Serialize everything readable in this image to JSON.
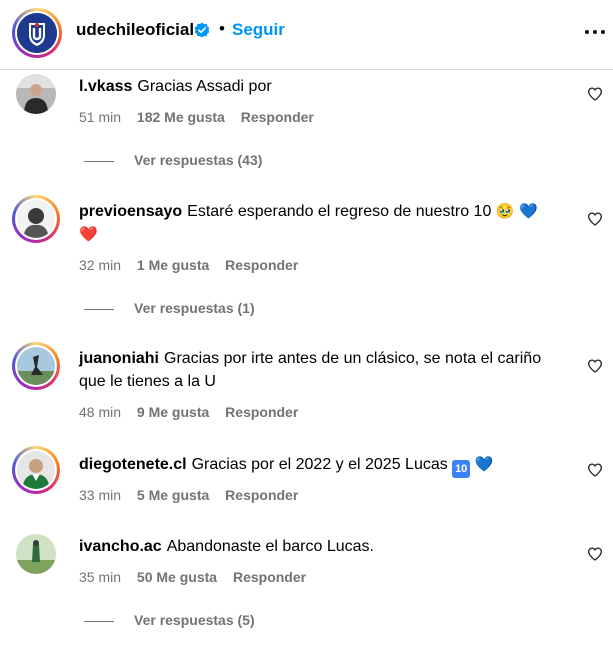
{
  "header": {
    "username": "udechileoficial",
    "separator": "•",
    "follow_label": "Seguir"
  },
  "comments": [
    {
      "user": "l.vkass",
      "text": "Gracias Assadi por",
      "time": "51 min",
      "likes": "182 Me gusta",
      "reply": "Responder",
      "view_replies": "Ver respuestas (43)"
    },
    {
      "user": "previoensayo",
      "text": "Estaré esperando el regreso de nuestro 10",
      "emoji_1": "🥹",
      "emoji_2": "💙",
      "emoji_3": "❤️",
      "time": "32 min",
      "likes": "1 Me gusta",
      "reply": "Responder",
      "view_replies": "Ver respuestas (1)"
    },
    {
      "user": "juanoniahi",
      "text": "Gracias por irte antes de un clásico, se nota el cariño que le tienes a la U",
      "time": "48 min",
      "likes": "9 Me gusta",
      "reply": "Responder"
    },
    {
      "user": "diegotenete.cl",
      "text": "Gracias por el 2022 y el 2025 Lucas",
      "badge": "10",
      "emoji_2": "💙",
      "time": "33 min",
      "likes": "5 Me gusta",
      "reply": "Responder"
    },
    {
      "user": "ivancho.ac",
      "text": "Abandonaste el barco Lucas.",
      "time": "35 min",
      "likes": "50 Me gusta",
      "reply": "Responder",
      "view_replies": "Ver respuestas (5)"
    }
  ],
  "colors": {
    "accent": "#0095f6",
    "muted": "#737373",
    "brand_blue": "#1d3a8f"
  }
}
